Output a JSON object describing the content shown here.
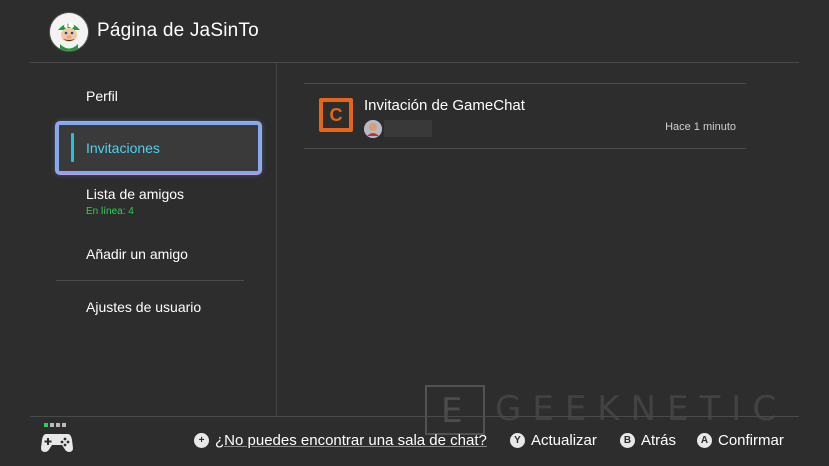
{
  "header": {
    "title": "Página de JaSinTo",
    "avatar_icon": "luigi-avatar-icon"
  },
  "sidebar": {
    "items": [
      {
        "label": "Perfil"
      },
      {
        "label": "Invitaciones",
        "active": true
      },
      {
        "label": "Lista de amigos",
        "sublabel": "En línea: 4"
      },
      {
        "label": "Añadir un amigo"
      },
      {
        "label": "Ajustes de usuario"
      }
    ]
  },
  "invitation": {
    "icon": "gamechat-icon",
    "icon_letter": "C",
    "title": "Invitación de GameChat",
    "time": "Hace 1 minuto"
  },
  "footer": {
    "help_button": "+",
    "help_link": "¿No puedes encontrar una sala de chat?",
    "y_button": "Y",
    "refresh_label": "Actualizar",
    "b_button": "B",
    "back_label": "Atrás",
    "a_button": "A",
    "confirm_label": "Confirmar"
  },
  "watermark": {
    "text": "GEEKNETIC",
    "letter": "E"
  },
  "colors": {
    "accent": "#1fc3e0",
    "online": "#27d352",
    "gamechat": "#e5661a",
    "background": "#2d2d2d"
  }
}
